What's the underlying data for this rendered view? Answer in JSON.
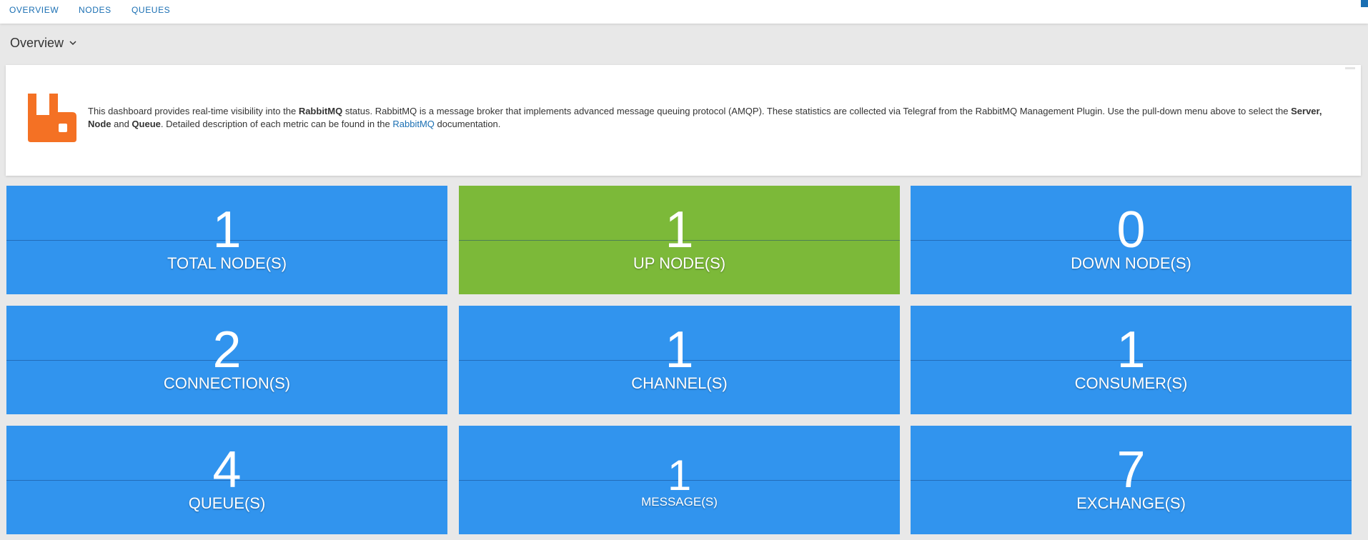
{
  "nav": {
    "overview": "OVERVIEW",
    "nodes": "NODES",
    "queues": "QUEUES"
  },
  "header": {
    "title": "Overview"
  },
  "info": {
    "text_1": "This dashboard provides real-time visibility into the ",
    "bold_rabbitmq": "RabbitMQ",
    "text_2": " status. RabbitMQ is a message broker that implements advanced message queuing protocol (AMQP). These statistics are collected via Telegraf from the RabbitMQ Management Plugin. Use the pull-down menu above to select the ",
    "bold_server_node": "Server, Node",
    "text_3": " and ",
    "bold_queue": "Queue",
    "text_4": ". Detailed description of each metric can be found in the ",
    "link": "RabbitMQ",
    "text_5": " documentation."
  },
  "colors": {
    "tile_blue": "#3194ee",
    "tile_green": "#7cb939",
    "logo_orange": "#f47124",
    "link_blue": "#1a6fb3"
  },
  "tiles": [
    {
      "value": "1",
      "label": "TOTAL NODE(S)"
    },
    {
      "value": "1",
      "label": "UP NODE(S)"
    },
    {
      "value": "0",
      "label": "DOWN NODE(S)"
    },
    {
      "value": "2",
      "label": "CONNECTION(S)"
    },
    {
      "value": "1",
      "label": "CHANNEL(S)"
    },
    {
      "value": "1",
      "label": "CONSUMER(S)"
    },
    {
      "value": "4",
      "label": "QUEUE(S)"
    },
    {
      "value": "1",
      "label": "MESSAGE(S)"
    },
    {
      "value": "7",
      "label": "EXCHANGE(S)"
    }
  ]
}
